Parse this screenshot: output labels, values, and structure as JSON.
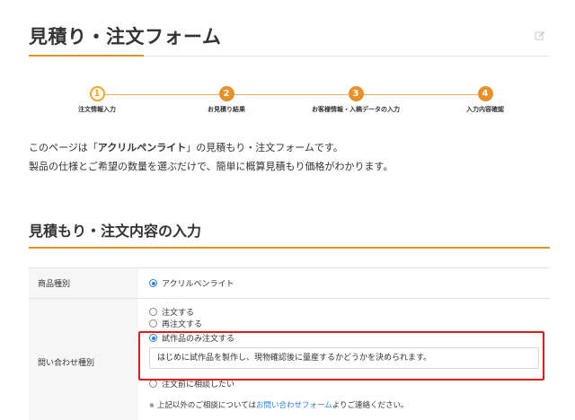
{
  "page": {
    "title": "見積り・注文フォーム"
  },
  "steps": [
    {
      "number": "1",
      "label": "注文情報入力"
    },
    {
      "number": "2",
      "label": "お見積り結果"
    },
    {
      "number": "3",
      "label": "お客様情報・入稿データの入力"
    },
    {
      "number": "4",
      "label": "入力内容確認"
    }
  ],
  "intro": {
    "line1_prefix": "このページは「",
    "line1_product": "アクリルペンライト",
    "line1_suffix": "」の見積もり・注文フォームです。",
    "line2": "製品の仕様とご希望の数量を選ぶだけで、簡単に概算見積もり価格がわかります。"
  },
  "section": {
    "title": "見積もり・注文内容の入力"
  },
  "form": {
    "product_type": {
      "label": "商品種別",
      "option": "アクリルペンライト"
    },
    "inquiry_type": {
      "label": "問い合わせ種別",
      "options": [
        "注文する",
        "再注文する",
        "試作品のみ注文する",
        "注文前に相談したい"
      ],
      "selected": "試作品のみ注文する",
      "textbox_value": "はじめに試作品を製作し、現物確認後に量産するかどうかを決められます。",
      "note_mark": "※",
      "note_prefix": "上記以外のご相談については",
      "note_link": "お問い合わせフォーム",
      "note_suffix": "よりご連絡ください。"
    }
  },
  "colors": {
    "accent": "#e8902a",
    "radio_checked": "#2d7fe0",
    "highlight_box": "#e01b1b"
  },
  "icons": {
    "edit": "edit-icon"
  }
}
